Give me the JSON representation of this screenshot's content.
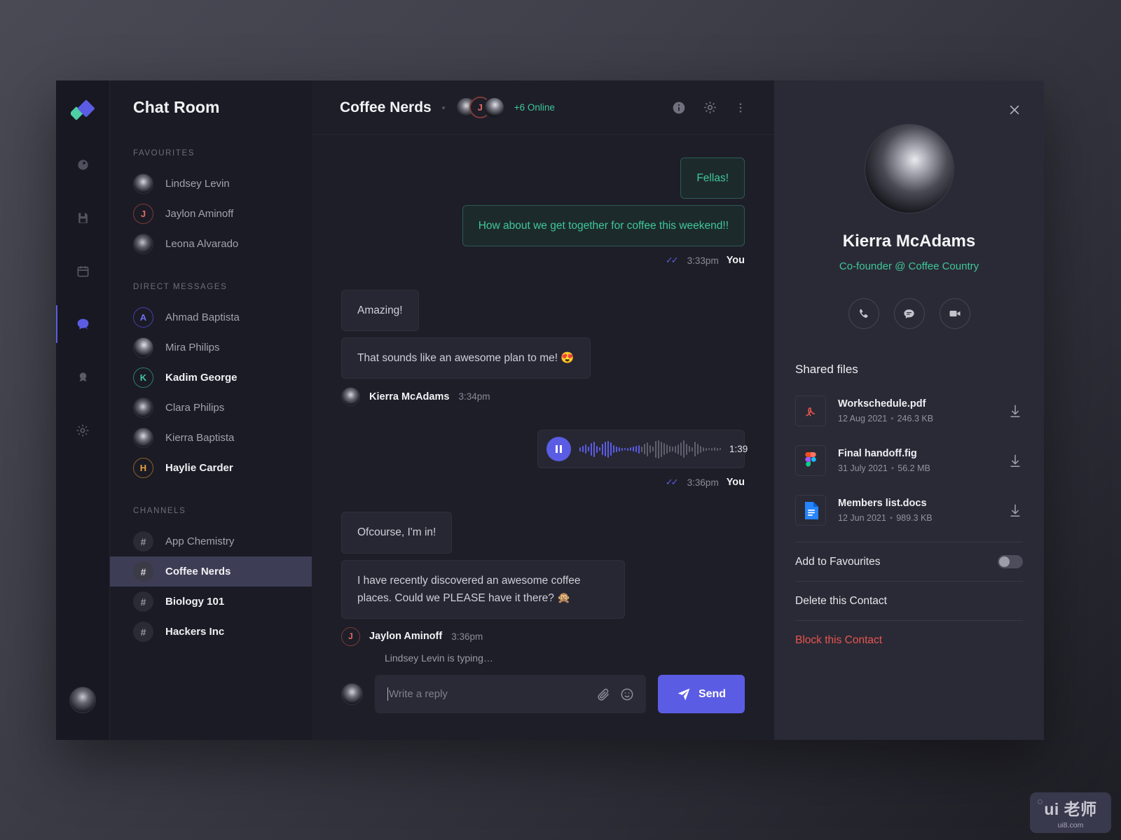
{
  "rail": {
    "logo_name": "app-logo",
    "items": [
      {
        "name": "dashboard-icon",
        "label": "Dashboard"
      },
      {
        "name": "save-icon",
        "label": "Saved"
      },
      {
        "name": "calendar-icon",
        "label": "Calendar"
      },
      {
        "name": "chat-icon",
        "label": "Chat"
      },
      {
        "name": "badge-icon",
        "label": "Awards"
      },
      {
        "name": "gear-icon",
        "label": "Settings"
      }
    ]
  },
  "sidebar": {
    "title": "Chat Room",
    "sections": [
      {
        "label": "FAVOURITES",
        "items": [
          {
            "name": "Lindsey Levin",
            "kind": "photo",
            "variant": "p1",
            "bold": false
          },
          {
            "name": "Jaylon Aminoff",
            "kind": "initial",
            "initial": "J",
            "color": "#e36b63",
            "bold": false
          },
          {
            "name": "Leona Alvarado",
            "kind": "photo",
            "variant": "p2",
            "bold": false
          }
        ]
      },
      {
        "label": "DIRECT MESSAGES",
        "items": [
          {
            "name": "Ahmad Baptista",
            "kind": "initial",
            "initial": "A",
            "color": "#6d6ef0",
            "bold": false
          },
          {
            "name": "Mira Philips",
            "kind": "photo",
            "variant": "p3",
            "bold": false
          },
          {
            "name": "Kadim George",
            "kind": "initial",
            "initial": "K",
            "color": "#3fc79a",
            "bold": true
          },
          {
            "name": "Clara Philips",
            "kind": "photo",
            "variant": "p4",
            "bold": false
          },
          {
            "name": "Kierra Baptista",
            "kind": "photo",
            "variant": "p1",
            "bold": false
          },
          {
            "name": "Haylie Carder",
            "kind": "initial",
            "initial": "H",
            "color": "#e9a23b",
            "bold": true
          }
        ]
      },
      {
        "label": "CHANNELS",
        "items": [
          {
            "name": "App Chemistry",
            "kind": "hash",
            "bold": false,
            "selected": false
          },
          {
            "name": "Coffee Nerds",
            "kind": "hash",
            "bold": true,
            "selected": true
          },
          {
            "name": "Biology 101",
            "kind": "hash",
            "bold": true,
            "selected": false
          },
          {
            "name": "Hackers Inc",
            "kind": "hash",
            "bold": true,
            "selected": false
          }
        ]
      }
    ]
  },
  "chat_header": {
    "title": "Coffee Nerds",
    "online_count": "+6",
    "online_label": "Online",
    "buttons": [
      "info-icon",
      "gear-icon",
      "more-vertical-icon"
    ]
  },
  "messages": [
    {
      "id": "m1",
      "direction": "out",
      "bubbles": [
        "Fellas!",
        "How about we get together for coffee this weekend!!"
      ],
      "time": "3:33pm",
      "author": "You",
      "read": true
    },
    {
      "id": "m2",
      "direction": "in",
      "bubbles": [
        "Amazing!",
        "That sounds like an awesome plan to me! 😍"
      ],
      "time": "3:34pm",
      "author": "Kierra McAdams"
    },
    {
      "id": "m3",
      "direction": "out",
      "type": "voice",
      "duration": "1:39",
      "time": "3:36pm",
      "author": "You",
      "read": true
    },
    {
      "id": "m4",
      "direction": "in",
      "bubbles": [
        "Ofcourse, I'm in!",
        "I have recently discovered an awesome coffee places. Could we PLEASE have it there? 🙊"
      ],
      "time": "3:36pm",
      "author": "Jaylon Aminoff"
    }
  ],
  "composer": {
    "typing_status": "Lindsey Levin is typing…",
    "placeholder": "Write a reply",
    "value": "",
    "send_label": "Send",
    "attach_icon": "paperclip-icon",
    "emoji_icon": "emoji-icon"
  },
  "profile": {
    "name": "Kierra McAdams",
    "role": "Co-founder @ Coffee Country",
    "actions": [
      {
        "name": "call-icon",
        "label": "Call"
      },
      {
        "name": "message-icon",
        "label": "Message"
      },
      {
        "name": "video-icon",
        "label": "Video"
      }
    ],
    "shared_files_title": "Shared files",
    "files": [
      {
        "name": "Workschedule.pdf",
        "date": "12 Aug 2021",
        "size": "246.3 KB",
        "type": "pdf"
      },
      {
        "name": "Final handoff.fig",
        "date": "31 July 2021",
        "size": "56.2 MB",
        "type": "figma"
      },
      {
        "name": "Members list.docs",
        "date": "12 Jun 2021",
        "size": "989.3 KB",
        "type": "docs"
      }
    ],
    "options": [
      {
        "label": "Add to Favourites",
        "kind": "toggle",
        "on": false
      },
      {
        "label": "Delete this Contact",
        "kind": "plain"
      },
      {
        "label": "Block this Contact",
        "kind": "danger"
      }
    ]
  },
  "watermark": {
    "main": "ui 老师",
    "sub": "ui8.com"
  },
  "colors": {
    "accent_purple": "#5b5ce4",
    "accent_teal": "#3fc79a",
    "danger_red": "#e8554d",
    "window_bg": "#1b1b25",
    "chat_bg": "#1e1e28",
    "panel_bg": "#2a2a36"
  }
}
